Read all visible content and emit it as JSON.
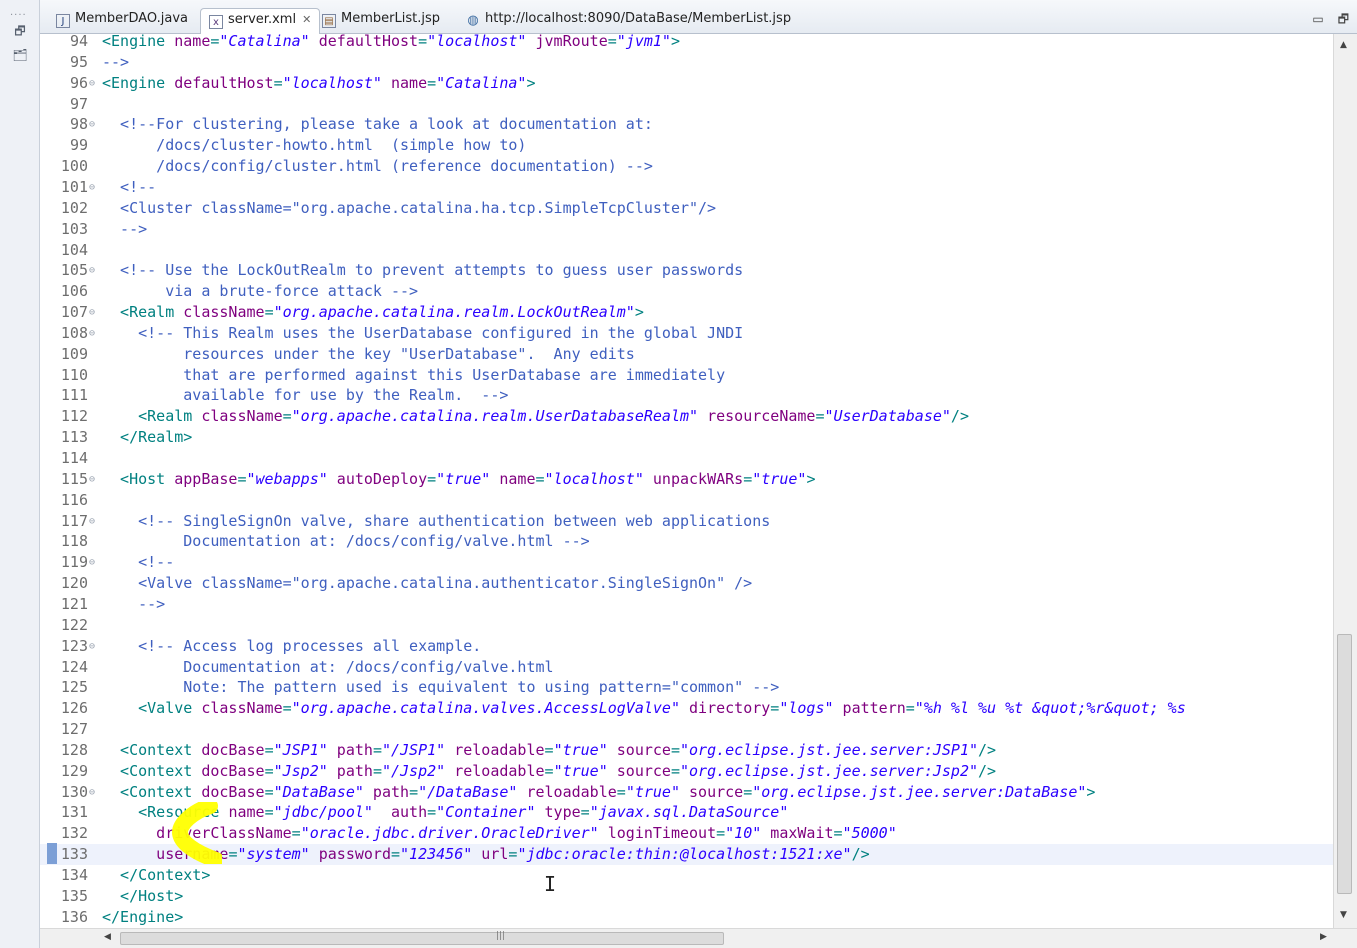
{
  "tabs": [
    {
      "label": "MemberDAO.java",
      "icon": "java-file-icon",
      "active": false
    },
    {
      "label": "server.xml",
      "icon": "xml-file-icon",
      "active": true
    },
    {
      "label": "MemberList.jsp",
      "icon": "jsp-file-icon",
      "active": false
    },
    {
      "label": "http://localhost:8090/DataBase/MemberList.jsp",
      "icon": "globe-icon",
      "active": false
    }
  ],
  "colors": {
    "tag": "#008080",
    "attribute": "#7f007f",
    "value": "#2a00ff",
    "comment": "#3f5fbf",
    "line_number": "#6d6d6d",
    "current_line": "#eef2fc",
    "highlighter": "#ffff00"
  },
  "editor": {
    "current_line": "133",
    "lines": [
      {
        "n": "94",
        "fold": "",
        "tokens": [
          [
            "t",
            "<Engine "
          ],
          [
            "a",
            "name"
          ],
          [
            "t",
            "="
          ],
          [
            "v",
            "\"Catalina\""
          ],
          [
            "a",
            " defaultHost"
          ],
          [
            "t",
            "="
          ],
          [
            "v",
            "\"localhost\""
          ],
          [
            "a",
            " jvmRoute"
          ],
          [
            "t",
            "="
          ],
          [
            "v",
            "\"jvm1\""
          ],
          [
            "t",
            ">"
          ]
        ]
      },
      {
        "n": "95",
        "fold": "",
        "tokens": [
          [
            "c",
            "-->"
          ]
        ]
      },
      {
        "n": "96",
        "fold": "⊖",
        "tokens": [
          [
            "t",
            "<Engine "
          ],
          [
            "a",
            "defaultHost"
          ],
          [
            "t",
            "="
          ],
          [
            "v",
            "\"localhost\""
          ],
          [
            "a",
            " name"
          ],
          [
            "t",
            "="
          ],
          [
            "v",
            "\"Catalina\""
          ],
          [
            "t",
            ">"
          ]
        ]
      },
      {
        "n": "97",
        "fold": "",
        "tokens": []
      },
      {
        "n": "98",
        "fold": "⊖",
        "tokens": [
          [
            "c",
            "  <!--For clustering, please take a look at documentation at:"
          ]
        ]
      },
      {
        "n": "99",
        "fold": "",
        "tokens": [
          [
            "c",
            "      /docs/cluster-howto.html  (simple how to)"
          ]
        ]
      },
      {
        "n": "100",
        "fold": "",
        "tokens": [
          [
            "c",
            "      /docs/config/cluster.html (reference documentation) -->"
          ]
        ]
      },
      {
        "n": "101",
        "fold": "⊖",
        "tokens": [
          [
            "c",
            "  <!--"
          ]
        ]
      },
      {
        "n": "102",
        "fold": "",
        "tokens": [
          [
            "c",
            "  <Cluster className=\"org.apache.catalina.ha.tcp.SimpleTcpCluster\"/>"
          ]
        ]
      },
      {
        "n": "103",
        "fold": "",
        "tokens": [
          [
            "c",
            "  -->"
          ]
        ]
      },
      {
        "n": "104",
        "fold": "",
        "tokens": []
      },
      {
        "n": "105",
        "fold": "⊖",
        "tokens": [
          [
            "c",
            "  <!-- Use the LockOutRealm to prevent attempts to guess user passwords"
          ]
        ]
      },
      {
        "n": "106",
        "fold": "",
        "tokens": [
          [
            "c",
            "       via a brute-force attack -->"
          ]
        ]
      },
      {
        "n": "107",
        "fold": "⊖",
        "tokens": [
          [
            "t",
            "  <Realm "
          ],
          [
            "a",
            "className"
          ],
          [
            "t",
            "="
          ],
          [
            "v",
            "\"org.apache.catalina.realm.LockOutRealm\""
          ],
          [
            "t",
            ">"
          ]
        ]
      },
      {
        "n": "108",
        "fold": "⊖",
        "tokens": [
          [
            "c",
            "    <!-- This Realm uses the UserDatabase configured in the global JNDI"
          ]
        ]
      },
      {
        "n": "109",
        "fold": "",
        "tokens": [
          [
            "c",
            "         resources under the key \"UserDatabase\".  Any edits"
          ]
        ]
      },
      {
        "n": "110",
        "fold": "",
        "tokens": [
          [
            "c",
            "         that are performed against this UserDatabase are immediately"
          ]
        ]
      },
      {
        "n": "111",
        "fold": "",
        "tokens": [
          [
            "c",
            "         available for use by the Realm.  -->"
          ]
        ]
      },
      {
        "n": "112",
        "fold": "",
        "tokens": [
          [
            "t",
            "    <Realm "
          ],
          [
            "a",
            "className"
          ],
          [
            "t",
            "="
          ],
          [
            "v",
            "\"org.apache.catalina.realm.UserDatabaseRealm\""
          ],
          [
            "a",
            " resourceName"
          ],
          [
            "t",
            "="
          ],
          [
            "v",
            "\"UserDatabase\""
          ],
          [
            "t",
            "/>"
          ]
        ]
      },
      {
        "n": "113",
        "fold": "",
        "tokens": [
          [
            "t",
            "  </Realm>"
          ]
        ]
      },
      {
        "n": "114",
        "fold": "",
        "tokens": []
      },
      {
        "n": "115",
        "fold": "⊖",
        "tokens": [
          [
            "t",
            "  <Host "
          ],
          [
            "a",
            "appBase"
          ],
          [
            "t",
            "="
          ],
          [
            "v",
            "\"webapps\""
          ],
          [
            "a",
            " autoDeploy"
          ],
          [
            "t",
            "="
          ],
          [
            "v",
            "\"true\""
          ],
          [
            "a",
            " name"
          ],
          [
            "t",
            "="
          ],
          [
            "v",
            "\"localhost\""
          ],
          [
            "a",
            " unpackWARs"
          ],
          [
            "t",
            "="
          ],
          [
            "v",
            "\"true\""
          ],
          [
            "t",
            ">"
          ]
        ]
      },
      {
        "n": "116",
        "fold": "",
        "tokens": []
      },
      {
        "n": "117",
        "fold": "⊖",
        "tokens": [
          [
            "c",
            "    <!-- SingleSignOn valve, share authentication between web applications"
          ]
        ]
      },
      {
        "n": "118",
        "fold": "",
        "tokens": [
          [
            "c",
            "         Documentation at: /docs/config/valve.html -->"
          ]
        ]
      },
      {
        "n": "119",
        "fold": "⊖",
        "tokens": [
          [
            "c",
            "    <!--"
          ]
        ]
      },
      {
        "n": "120",
        "fold": "",
        "tokens": [
          [
            "c",
            "    <Valve className=\"org.apache.catalina.authenticator.SingleSignOn\" />"
          ]
        ]
      },
      {
        "n": "121",
        "fold": "",
        "tokens": [
          [
            "c",
            "    -->"
          ]
        ]
      },
      {
        "n": "122",
        "fold": "",
        "tokens": []
      },
      {
        "n": "123",
        "fold": "⊖",
        "tokens": [
          [
            "c",
            "    <!-- Access log processes all example."
          ]
        ]
      },
      {
        "n": "124",
        "fold": "",
        "tokens": [
          [
            "c",
            "         Documentation at: /docs/config/valve.html"
          ]
        ]
      },
      {
        "n": "125",
        "fold": "",
        "tokens": [
          [
            "c",
            "         Note: The pattern used is equivalent to using pattern=\"common\" -->"
          ]
        ]
      },
      {
        "n": "126",
        "fold": "",
        "tokens": [
          [
            "t",
            "    <Valve "
          ],
          [
            "a",
            "className"
          ],
          [
            "t",
            "="
          ],
          [
            "v",
            "\"org.apache.catalina.valves.AccessLogValve\""
          ],
          [
            "a",
            " directory"
          ],
          [
            "t",
            "="
          ],
          [
            "v",
            "\"logs\""
          ],
          [
            "a",
            " pattern"
          ],
          [
            "t",
            "="
          ],
          [
            "v",
            "\"%h %l %u %t &quot;%r&quot; %s"
          ]
        ]
      },
      {
        "n": "127",
        "fold": "",
        "tokens": []
      },
      {
        "n": "128",
        "fold": "",
        "tokens": [
          [
            "t",
            "  <Context "
          ],
          [
            "a",
            "docBase"
          ],
          [
            "t",
            "="
          ],
          [
            "v",
            "\"JSP1\""
          ],
          [
            "a",
            " path"
          ],
          [
            "t",
            "="
          ],
          [
            "v",
            "\"/JSP1\""
          ],
          [
            "a",
            " reloadable"
          ],
          [
            "t",
            "="
          ],
          [
            "v",
            "\"true\""
          ],
          [
            "a",
            " source"
          ],
          [
            "t",
            "="
          ],
          [
            "v",
            "\"org.eclipse.jst.jee.server:JSP1\""
          ],
          [
            "t",
            "/>"
          ]
        ]
      },
      {
        "n": "129",
        "fold": "",
        "tokens": [
          [
            "t",
            "  <Context "
          ],
          [
            "a",
            "docBase"
          ],
          [
            "t",
            "="
          ],
          [
            "v",
            "\"Jsp2\""
          ],
          [
            "a",
            " path"
          ],
          [
            "t",
            "="
          ],
          [
            "v",
            "\"/Jsp2\""
          ],
          [
            "a",
            " reloadable"
          ],
          [
            "t",
            "="
          ],
          [
            "v",
            "\"true\""
          ],
          [
            "a",
            " source"
          ],
          [
            "t",
            "="
          ],
          [
            "v",
            "\"org.eclipse.jst.jee.server:Jsp2\""
          ],
          [
            "t",
            "/>"
          ]
        ]
      },
      {
        "n": "130",
        "fold": "⊖",
        "tokens": [
          [
            "t",
            "  <Context "
          ],
          [
            "a",
            "docBase"
          ],
          [
            "t",
            "="
          ],
          [
            "v",
            "\"DataBase\""
          ],
          [
            "a",
            " path"
          ],
          [
            "t",
            "="
          ],
          [
            "v",
            "\"/DataBase\""
          ],
          [
            "a",
            " reloadable"
          ],
          [
            "t",
            "="
          ],
          [
            "v",
            "\"true\""
          ],
          [
            "a",
            " source"
          ],
          [
            "t",
            "="
          ],
          [
            "v",
            "\"org.eclipse.jst.jee.server:DataBase\""
          ],
          [
            "t",
            ">"
          ]
        ]
      },
      {
        "n": "131",
        "fold": "",
        "tokens": [
          [
            "t",
            "    <Resource "
          ],
          [
            "a",
            "name"
          ],
          [
            "t",
            "="
          ],
          [
            "v",
            "\"jdbc/pool\""
          ],
          [
            "a",
            "  auth"
          ],
          [
            "t",
            "="
          ],
          [
            "v",
            "\"Container\""
          ],
          [
            "a",
            " type"
          ],
          [
            "t",
            "="
          ],
          [
            "v",
            "\"javax.sql.DataSource\""
          ]
        ]
      },
      {
        "n": "132",
        "fold": "",
        "tokens": [
          [
            "a",
            "      driverClassName"
          ],
          [
            "t",
            "="
          ],
          [
            "v",
            "\"oracle.jdbc.driver.OracleDriver\""
          ],
          [
            "a",
            " loginTimeout"
          ],
          [
            "t",
            "="
          ],
          [
            "v",
            "\"10\""
          ],
          [
            "a",
            " maxWait"
          ],
          [
            "t",
            "="
          ],
          [
            "v",
            "\"5000\""
          ]
        ]
      },
      {
        "n": "133",
        "fold": "",
        "tokens": [
          [
            "a",
            "      username"
          ],
          [
            "t",
            "="
          ],
          [
            "v",
            "\"system\""
          ],
          [
            "a",
            " password"
          ],
          [
            "t",
            "="
          ],
          [
            "v",
            "\"123456\""
          ],
          [
            "a",
            " url"
          ],
          [
            "t",
            "="
          ],
          [
            "v",
            "\"jdbc:oracle:thin:@localhost:1521:xe\""
          ],
          [
            "t",
            "/>"
          ]
        ]
      },
      {
        "n": "134",
        "fold": "",
        "tokens": [
          [
            "t",
            "  </Context>"
          ]
        ]
      },
      {
        "n": "135",
        "fold": "",
        "tokens": [
          [
            "t",
            "  </Host>"
          ]
        ]
      },
      {
        "n": "136",
        "fold": "",
        "tokens": [
          [
            "t",
            "</Engine>"
          ]
        ]
      }
    ]
  }
}
